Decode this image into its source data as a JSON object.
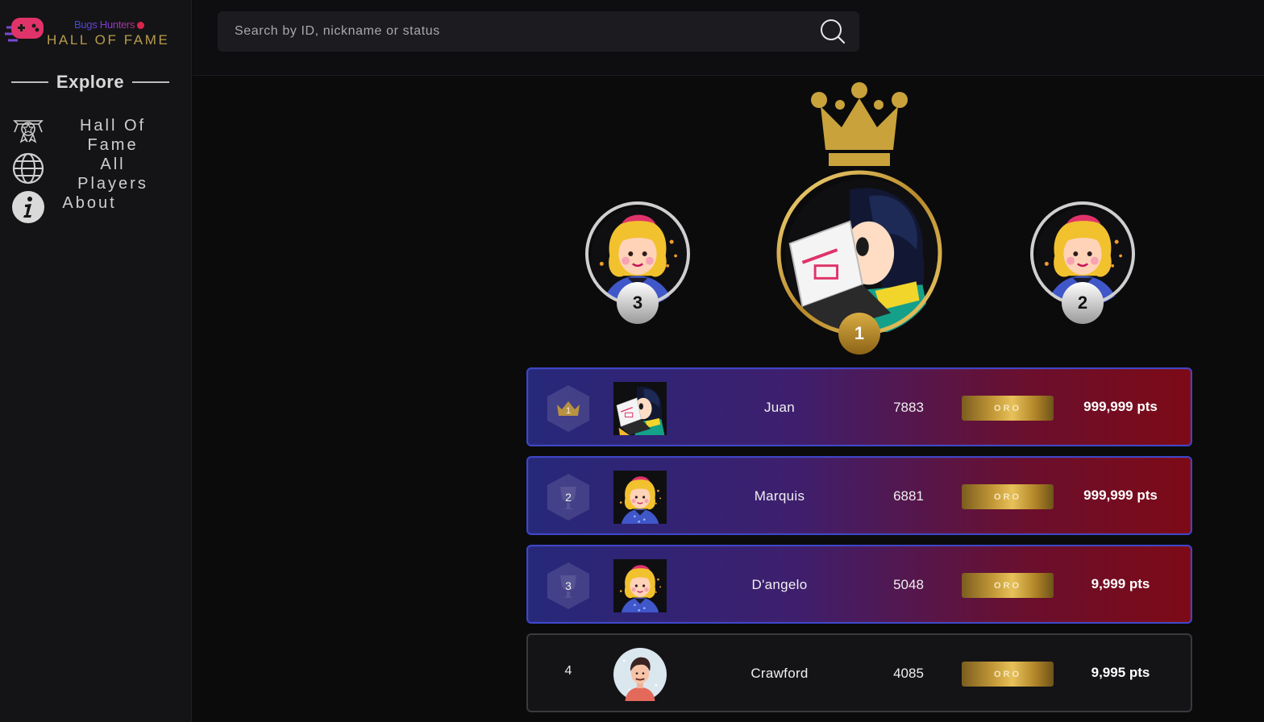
{
  "brand": {
    "subtitle": "Bugs Hunters",
    "title": "HALL OF FAME"
  },
  "sidebar": {
    "section_title": "Explore",
    "items": [
      {
        "label": "Hall Of Fame",
        "lines": [
          "Hall Of",
          "Fame"
        ],
        "icon": "trophy-badge-icon"
      },
      {
        "label": "All Players",
        "lines": [
          "All",
          "Players"
        ],
        "icon": "globe-icon"
      },
      {
        "label": "About",
        "lines": [
          "About"
        ],
        "icon": "info-icon"
      }
    ]
  },
  "search": {
    "placeholder": "Search by ID, nickname or status",
    "value": "",
    "icon": "search-icon"
  },
  "podium": {
    "first": {
      "rank": "1",
      "icon": "crown-icon"
    },
    "second": {
      "rank": "2"
    },
    "third": {
      "rank": "3"
    }
  },
  "leaderboard": [
    {
      "rank": "1",
      "name": "Juan",
      "id": "7883",
      "tier": "ORO",
      "points": "999,999 pts",
      "avatar": "girl-laptop-avatar",
      "rank_icon": "crown-icon"
    },
    {
      "rank": "2",
      "name": "Marquis",
      "id": "6881",
      "tier": "ORO",
      "points": "999,999 pts",
      "avatar": "blonde-girl-avatar",
      "rank_icon": "trophy-icon"
    },
    {
      "rank": "3",
      "name": "D'angelo",
      "id": "5048",
      "tier": "ORO",
      "points": "9,999 pts",
      "avatar": "blonde-girl-avatar",
      "rank_icon": "trophy-icon"
    },
    {
      "rank": "4",
      "name": "Crawford",
      "id": "4085",
      "tier": "ORO",
      "points": "9,995 pts",
      "avatar": "man-avatar"
    }
  ],
  "colors": {
    "gold": "#c9a23c",
    "row_blue": "#26287a",
    "row_red": "#7d0a16",
    "accent_pink": "#e0336a"
  }
}
